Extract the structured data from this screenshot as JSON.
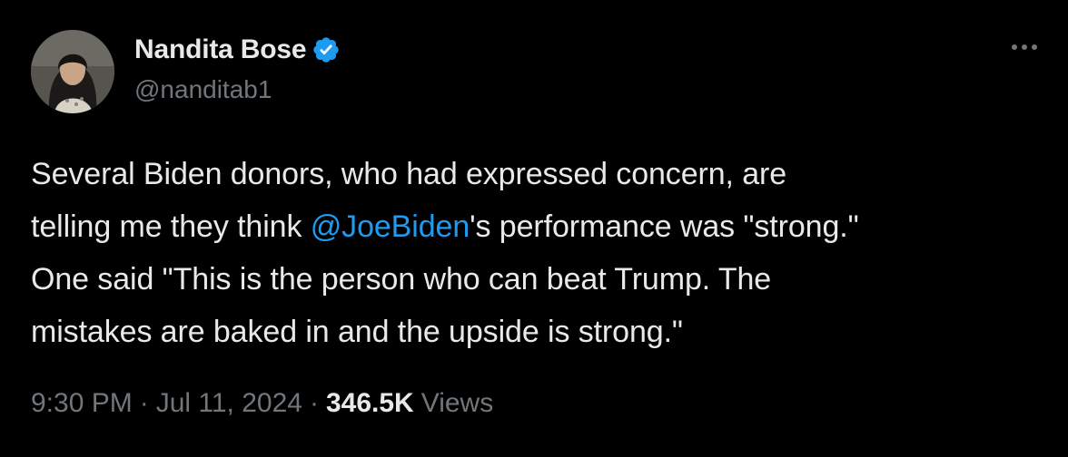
{
  "author": {
    "display_name": "Nandita Bose",
    "handle": "@nanditab1",
    "verified": true
  },
  "tweet": {
    "lines": [
      {
        "before": "Several Biden donors, who had expressed concern, are",
        "mention": "",
        "after": ""
      },
      {
        "before": "telling me they think ",
        "mention": "@JoeBiden",
        "after": "'s performance was \"strong.\""
      },
      {
        "before": "One said \"This is the person who can beat Trump. The",
        "mention": "",
        "after": ""
      },
      {
        "before": "mistakes are baked in and the upside is strong.\"",
        "mention": "",
        "after": ""
      }
    ]
  },
  "meta": {
    "time": "9:30 PM",
    "separator": "·",
    "date": "Jul 11, 2024",
    "views_count": "346.5K",
    "views_label": "Views"
  },
  "colors": {
    "background": "#000000",
    "text": "#e7e9ea",
    "secondary": "#71767b",
    "link": "#1d9bf0",
    "verified": "#1d9bf0"
  },
  "icons": {
    "verified": "verified-badge-icon",
    "more": "more-dots-icon"
  }
}
